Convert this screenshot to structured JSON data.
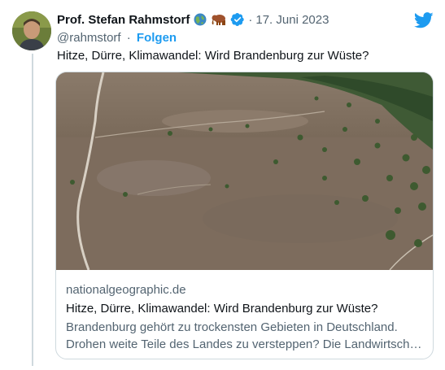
{
  "tweet": {
    "author_name": "Prof. Stefan Rahmstorf",
    "badges": [
      "globe-emoji",
      "mammoth-emoji",
      "verified-badge"
    ],
    "date": "17. Juni 2023",
    "separator": "·",
    "handle": "@rahmstorf",
    "follow_label": "Folgen",
    "text": "Hitze, Dürre, Klimawandel: Wird Brandenburg zur Wüste?"
  },
  "card": {
    "image": "aerial-dry-heathland-photo",
    "domain": "nationalgeographic.de",
    "title": "Hitze, Dürre, Klimawandel: Wird Brandenburg zur Wüste?",
    "description_line1": "Brandenburg gehört zu trockensten Gebieten in Deutschland.",
    "description_line2": "Drohen weite Teile des Landes zu versteppen? Die Landwirtschaft…"
  },
  "colors": {
    "accent": "#1d9bf0",
    "text": "#0f1419",
    "muted": "#536471",
    "border": "#cfd9de"
  },
  "icons": {
    "platform": "twitter-bird-icon"
  }
}
